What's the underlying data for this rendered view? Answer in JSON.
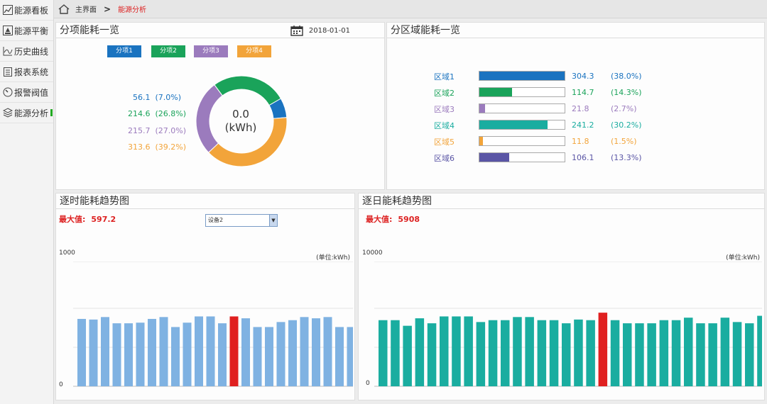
{
  "sidebar": {
    "items": [
      {
        "label": "能源看板",
        "icon": "line-chart-icon"
      },
      {
        "label": "能源平衡",
        "icon": "balance-icon"
      },
      {
        "label": "历史曲线",
        "icon": "curve-icon"
      },
      {
        "label": "报表系统",
        "icon": "report-icon"
      },
      {
        "label": "报警阀值",
        "icon": "alarm-icon"
      },
      {
        "label": "能源分析",
        "icon": "layers-icon"
      }
    ]
  },
  "breadcrumb": {
    "home": "主界面",
    "separator": ">",
    "current": "能源分析"
  },
  "panel1": {
    "title": "分项能耗一览",
    "date": "2018-01-01",
    "legend": [
      {
        "label": "分项1",
        "color": "#1a73c0"
      },
      {
        "label": "分项2",
        "color": "#1aa35a"
      },
      {
        "label": "分项3",
        "color": "#9b7bbd"
      },
      {
        "label": "分项4",
        "color": "#f2a43a"
      }
    ],
    "items": [
      {
        "value": "56.1",
        "pct": "(7.0%)",
        "color": "#1a73c0"
      },
      {
        "value": "214.6",
        "pct": "(26.8%)",
        "color": "#1aa35a"
      },
      {
        "value": "215.7",
        "pct": "(27.0%)",
        "color": "#9b7bbd"
      },
      {
        "value": "313.6",
        "pct": "(39.2%)",
        "color": "#f2a43a"
      }
    ],
    "center_value": "0.0",
    "center_unit": "(kWh)"
  },
  "panel2": {
    "title": "分区域能耗一览",
    "zones": [
      {
        "name": "区域1",
        "value": "304.3",
        "pct": "(38.0%)",
        "fraction": 1.0,
        "color": "#1a73c0"
      },
      {
        "name": "区域2",
        "value": "114.7",
        "pct": "(14.3%)",
        "fraction": 0.38,
        "color": "#1aa35a"
      },
      {
        "name": "区域3",
        "value": "21.8",
        "pct": "(2.7%)",
        "fraction": 0.07,
        "color": "#9b7bbd"
      },
      {
        "name": "区域4",
        "value": "241.2",
        "pct": "(30.2%)",
        "fraction": 0.8,
        "color": "#1aada0"
      },
      {
        "name": "区域5",
        "value": "11.8",
        "pct": "(1.5%)",
        "fraction": 0.04,
        "color": "#f2a43a"
      },
      {
        "name": "区域6",
        "value": "106.1",
        "pct": "(13.3%)",
        "fraction": 0.35,
        "color": "#5a55a5"
      }
    ]
  },
  "panel3": {
    "title": "逐时能耗趋势图",
    "max_label": "最大值:",
    "max_value": "597.2",
    "select_value": "设备2",
    "unit": "(单位:kWh)"
  },
  "panel4": {
    "title": "逐日能耗趋势图",
    "max_label": "最大值:",
    "max_value": "5908",
    "unit": "(单位:kWh)"
  },
  "chart_data": [
    {
      "type": "bar",
      "title": "逐时能耗趋势图",
      "ylim": [
        0,
        1000
      ],
      "ytick_labels": [
        "0",
        "1000"
      ],
      "ylabel": "(单位:kWh)",
      "color": "#7fb2e2",
      "highlight_color": "#e02020",
      "highlight_index": 13,
      "values": [
        540,
        535,
        555,
        505,
        505,
        510,
        540,
        555,
        475,
        510,
        560,
        560,
        505,
        560,
        545,
        475,
        475,
        515,
        530,
        555,
        545,
        555,
        475,
        475
      ]
    },
    {
      "type": "bar",
      "title": "逐日能耗趋势图",
      "ylim": [
        0,
        10000
      ],
      "ytick_labels": [
        "0",
        "10000"
      ],
      "ylabel": "(单位:kWh)",
      "color": "#1aada0",
      "highlight_color": "#e02020",
      "highlight_index": 18,
      "values": [
        5300,
        5300,
        4850,
        5450,
        5050,
        5600,
        5600,
        5600,
        5150,
        5300,
        5300,
        5550,
        5550,
        5300,
        5300,
        5050,
        5350,
        5300,
        5900,
        5300,
        5050,
        5050,
        5050,
        5300,
        5300,
        5500,
        5050,
        5050,
        5500,
        5150,
        5050,
        5650
      ]
    }
  ]
}
